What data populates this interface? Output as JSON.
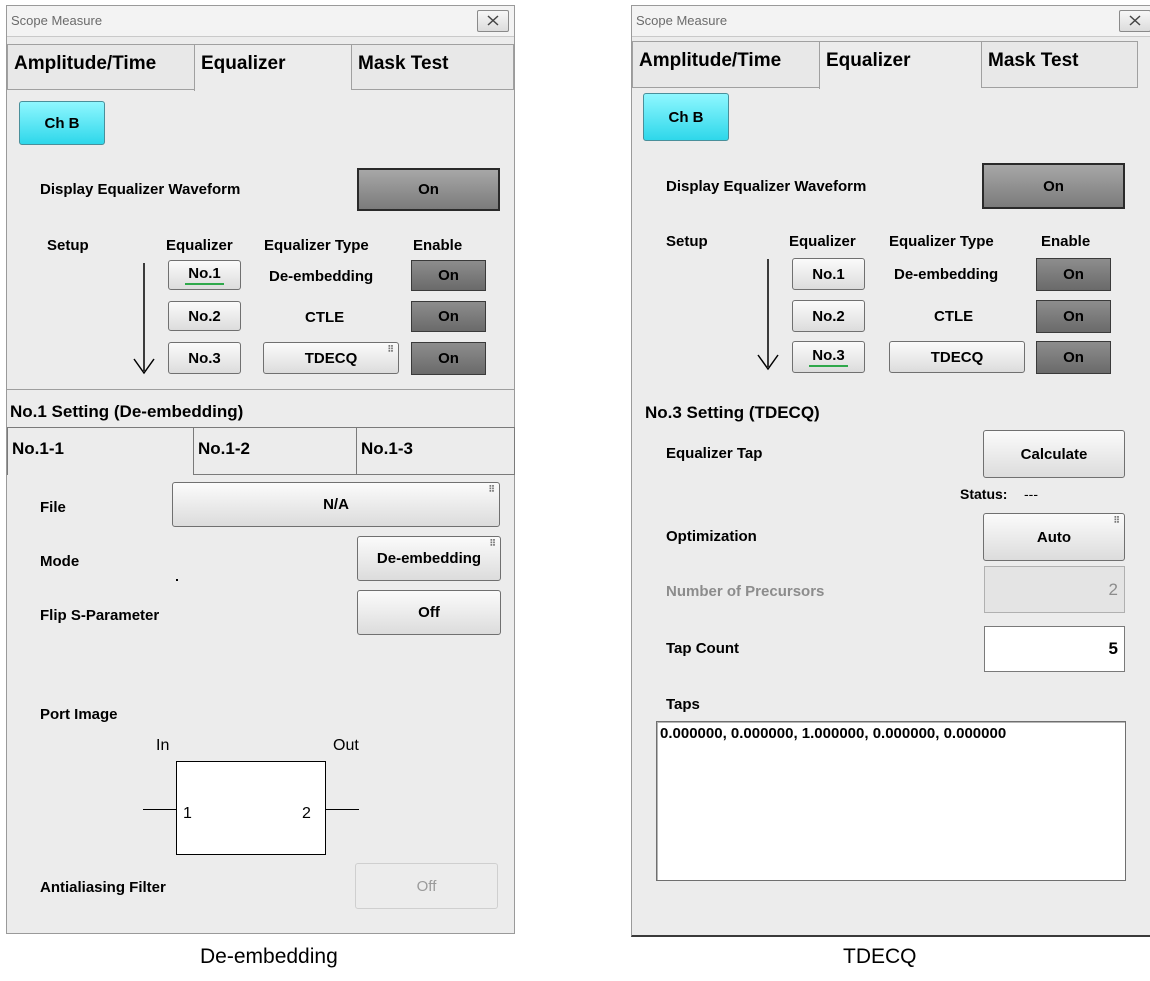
{
  "left": {
    "title": "Scope Measure",
    "tabs": [
      "Amplitude/Time",
      "Equalizer",
      "Mask Test"
    ],
    "channel_button": "Ch B",
    "display_label": "Display Equalizer Waveform",
    "display_value": "On",
    "headers": {
      "setup": "Setup",
      "equalizer": "Equalizer",
      "type": "Equalizer Type",
      "enable": "Enable"
    },
    "rows": [
      {
        "eq": "No.1",
        "type": "De-embedding",
        "enable": "On"
      },
      {
        "eq": "No.2",
        "type": "CTLE",
        "enable": "On"
      },
      {
        "eq": "No.3",
        "type": "TDECQ",
        "enable": "On"
      }
    ],
    "section_title": "No.1 Setting (De-embedding)",
    "subtabs": [
      "No.1-1",
      "No.1-2",
      "No.1-3"
    ],
    "file_label": "File",
    "file_value": "N/A",
    "mode_label": "Mode",
    "mode_value": "De-embedding",
    "flip_label": "Flip S-Parameter",
    "flip_value": "Off",
    "port_label": "Port Image",
    "port_in": "In",
    "port_out": "Out",
    "port_1": "1",
    "port_2": "2",
    "aa_label": "Antialiasing Filter",
    "aa_value": "Off",
    "caption": "De-embedding"
  },
  "right": {
    "title": "Scope Measure",
    "tabs": [
      "Amplitude/Time",
      "Equalizer",
      "Mask Test"
    ],
    "channel_button": "Ch B",
    "display_label": "Display Equalizer Waveform",
    "display_value": "On",
    "headers": {
      "setup": "Setup",
      "equalizer": "Equalizer",
      "type": "Equalizer Type",
      "enable": "Enable"
    },
    "rows": [
      {
        "eq": "No.1",
        "type": "De-embedding",
        "enable": "On"
      },
      {
        "eq": "No.2",
        "type": "CTLE",
        "enable": "On"
      },
      {
        "eq": "No.3",
        "type": "TDECQ",
        "enable": "On"
      }
    ],
    "section_title": "No.3 Setting (TDECQ)",
    "tap_label": "Equalizer Tap",
    "calc_button": "Calculate",
    "status_label": "Status:",
    "status_value": "---",
    "opt_label": "Optimization",
    "opt_value": "Auto",
    "precursors_label": "Number of Precursors",
    "precursors_value": "2",
    "tapcount_label": "Tap Count",
    "tapcount_value": "5",
    "taps_label": "Taps",
    "taps_value": "0.000000, 0.000000, 1.000000, 0.000000, 0.000000",
    "caption": "TDECQ"
  },
  "colors": {
    "channel_cyan": "#2ed7ea",
    "highlight_green": "#2fa84b",
    "panel_bg": "#ececec"
  }
}
